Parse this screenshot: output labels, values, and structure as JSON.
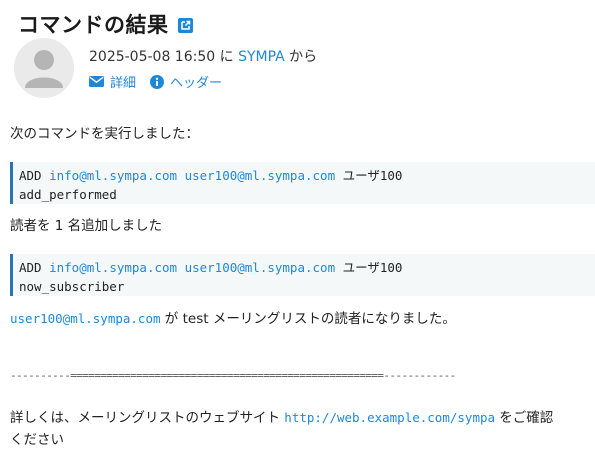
{
  "header": {
    "title": "コマンドの結果",
    "external_link_icon": "external-link-icon"
  },
  "meta": {
    "datetime": "2025-05-08 16:50",
    "ni": " に ",
    "sender": "SYMPA",
    "kara": " から",
    "details_label": "詳細",
    "header_label": "ヘッダー"
  },
  "body": {
    "intro": "次のコマンドを実行しました：",
    "block1": {
      "cmd": "ADD",
      "list_addr": "info@ml.sympa.com",
      "user_addr": "user100@ml.sympa.com",
      "user_name": "ユーザ100",
      "result": "add_performed"
    },
    "added_message": "読者を 1 名追加しました",
    "block2": {
      "cmd": "ADD",
      "list_addr": "info@ml.sympa.com",
      "user_addr": "user100@ml.sympa.com",
      "user_name": "ユーザ100",
      "result": "now_subscriber"
    },
    "subscriber_addr": "user100@ml.sympa.com",
    "subscriber_msg": " が test メーリングリストの読者になりました。",
    "separator": "----------====================================================------------",
    "footer_pre": "詳しくは、メーリングリストのウェブサイト ",
    "footer_link": "http://web.example.com/sympa",
    "footer_post": " をご確認",
    "footer_line2": "ください"
  },
  "colors": {
    "accent": "#1e88d8",
    "block_border": "#2b74b3",
    "block_bg": "#f5f8f9"
  }
}
